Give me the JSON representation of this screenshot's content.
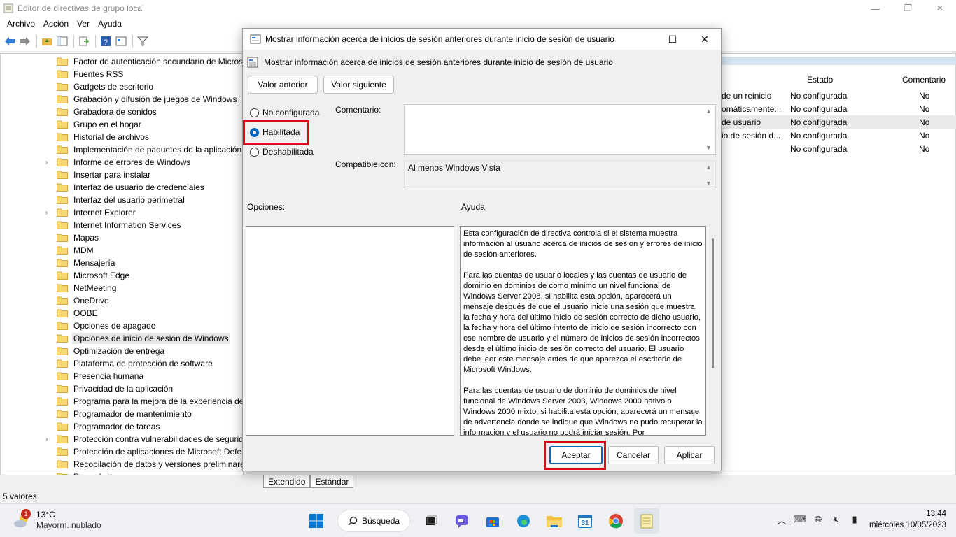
{
  "window": {
    "title": "Editor de directivas de grupo local"
  },
  "menu": [
    "Archivo",
    "Acción",
    "Ver",
    "Ayuda"
  ],
  "tree": {
    "items": [
      {
        "label": "Factor de autenticación secundario de Microsoft",
        "expandable": false
      },
      {
        "label": "Fuentes RSS",
        "expandable": false
      },
      {
        "label": "Gadgets de escritorio",
        "expandable": false
      },
      {
        "label": "Grabación y difusión de juegos de Windows",
        "expandable": false
      },
      {
        "label": "Grabadora de sonidos",
        "expandable": false
      },
      {
        "label": "Grupo en el hogar",
        "expandable": false
      },
      {
        "label": "Historial de archivos",
        "expandable": false
      },
      {
        "label": "Implementación de paquetes de la aplicación",
        "expandable": false
      },
      {
        "label": "Informe de errores de Windows",
        "expandable": true
      },
      {
        "label": "Insertar para instalar",
        "expandable": false
      },
      {
        "label": "Interfaz de usuario de credenciales",
        "expandable": false
      },
      {
        "label": "Interfaz del usuario perimetral",
        "expandable": false
      },
      {
        "label": "Internet Explorer",
        "expandable": true
      },
      {
        "label": "Internet Information Services",
        "expandable": false
      },
      {
        "label": "Mapas",
        "expandable": false
      },
      {
        "label": "MDM",
        "expandable": false
      },
      {
        "label": "Mensajería",
        "expandable": false
      },
      {
        "label": "Microsoft Edge",
        "expandable": false
      },
      {
        "label": "NetMeeting",
        "expandable": false
      },
      {
        "label": "OneDrive",
        "expandable": false
      },
      {
        "label": "OOBE",
        "expandable": false
      },
      {
        "label": "Opciones de apagado",
        "expandable": false
      },
      {
        "label": "Opciones de inicio de sesión de Windows",
        "expandable": false,
        "selected": true
      },
      {
        "label": "Optimización de entrega",
        "expandable": false
      },
      {
        "label": "Plataforma de protección de software",
        "expandable": false
      },
      {
        "label": "Presencia humana",
        "expandable": false
      },
      {
        "label": "Privacidad de la aplicación",
        "expandable": false
      },
      {
        "label": "Programa para la mejora de la experiencia del cliente",
        "expandable": false
      },
      {
        "label": "Programador de mantenimiento",
        "expandable": false
      },
      {
        "label": "Programador de tareas",
        "expandable": false
      },
      {
        "label": "Protección contra vulnerabilidades de seguridad",
        "expandable": true
      },
      {
        "label": "Protección de aplicaciones de Microsoft Defender",
        "expandable": false
      },
      {
        "label": "Recopilación de datos y versiones preliminares",
        "expandable": false
      },
      {
        "label": "Reproductor",
        "expandable": false
      }
    ]
  },
  "list": {
    "col_estado": "Estado",
    "col_comentario": "Comentario",
    "rows": [
      {
        "setting": "de un reinicio",
        "estado": "No configurada",
        "comentario": "No"
      },
      {
        "setting": "omáticamente...",
        "estado": "No configurada",
        "comentario": "No"
      },
      {
        "setting": "de usuario",
        "estado": "No configurada",
        "comentario": "No",
        "highlight": true
      },
      {
        "setting": "io de sesión d...",
        "estado": "No configurada",
        "comentario": "No"
      },
      {
        "setting": "",
        "estado": "No configurada",
        "comentario": "No"
      }
    ]
  },
  "tabs": {
    "extendido": "Extendido",
    "estandar": "Estándar"
  },
  "status": {
    "count": "5 valores"
  },
  "dialog": {
    "title": "Mostrar información acerca de inicios de sesión anteriores durante inicio de sesión de usuario",
    "header": "Mostrar información acerca de inicios de sesión anteriores durante inicio de sesión de usuario",
    "prev_button": "Valor anterior",
    "next_button": "Valor siguiente",
    "radio_not_configured": "No configurada",
    "radio_enabled": "Habilitada",
    "radio_disabled": "Deshabilitada",
    "comment_label": "Comentario:",
    "comment_value": "",
    "supported_label": "Compatible con:",
    "supported_value": "Al menos Windows Vista",
    "options_label": "Opciones:",
    "help_label": "Ayuda:",
    "help_paragraphs": [
      "Esta configuración de directiva controla si el sistema muestra información al usuario acerca de inicios de sesión y errores de inicio de sesión anteriores.",
      "Para las cuentas de usuario locales y las cuentas de usuario de dominio en dominios de como mínimo un nivel funcional de Windows Server 2008, si habilita esta opción, aparecerá un mensaje después de que el usuario inicie una sesión que muestra la fecha y hora del último inicio de sesión correcto de dicho usuario, la fecha y hora del último intento de inicio de sesión incorrecto con ese nombre de usuario y el número de inicios de sesión incorrectos desde el último inicio de sesión correcto del usuario. El usuario debe leer este mensaje antes de que aparezca el escritorio de Microsoft Windows.",
      "Para las cuentas de usuario de dominio de dominios de nivel funcional de Windows Server 2003, Windows 2000 nativo o Windows 2000 mixto, si habilita esta opción, aparecerá un mensaje de advertencia donde se indique que Windows no pudo recuperar la información y el usuario no podrá iniciar sesión. Por"
    ],
    "ok_button": "Aceptar",
    "cancel_button": "Cancelar",
    "apply_button": "Aplicar"
  },
  "taskbar": {
    "weather_badge": "1",
    "temperature": "13°C",
    "weather_desc": "Mayorm. nublado",
    "search_label": "Búsqueda",
    "calendar_day": "31",
    "time": "13:44",
    "date": "miércoles 10/05/2023"
  },
  "colors": {
    "accent": "#0067c0",
    "highlight_red": "#e3001b",
    "folder": "#e8b94a"
  }
}
